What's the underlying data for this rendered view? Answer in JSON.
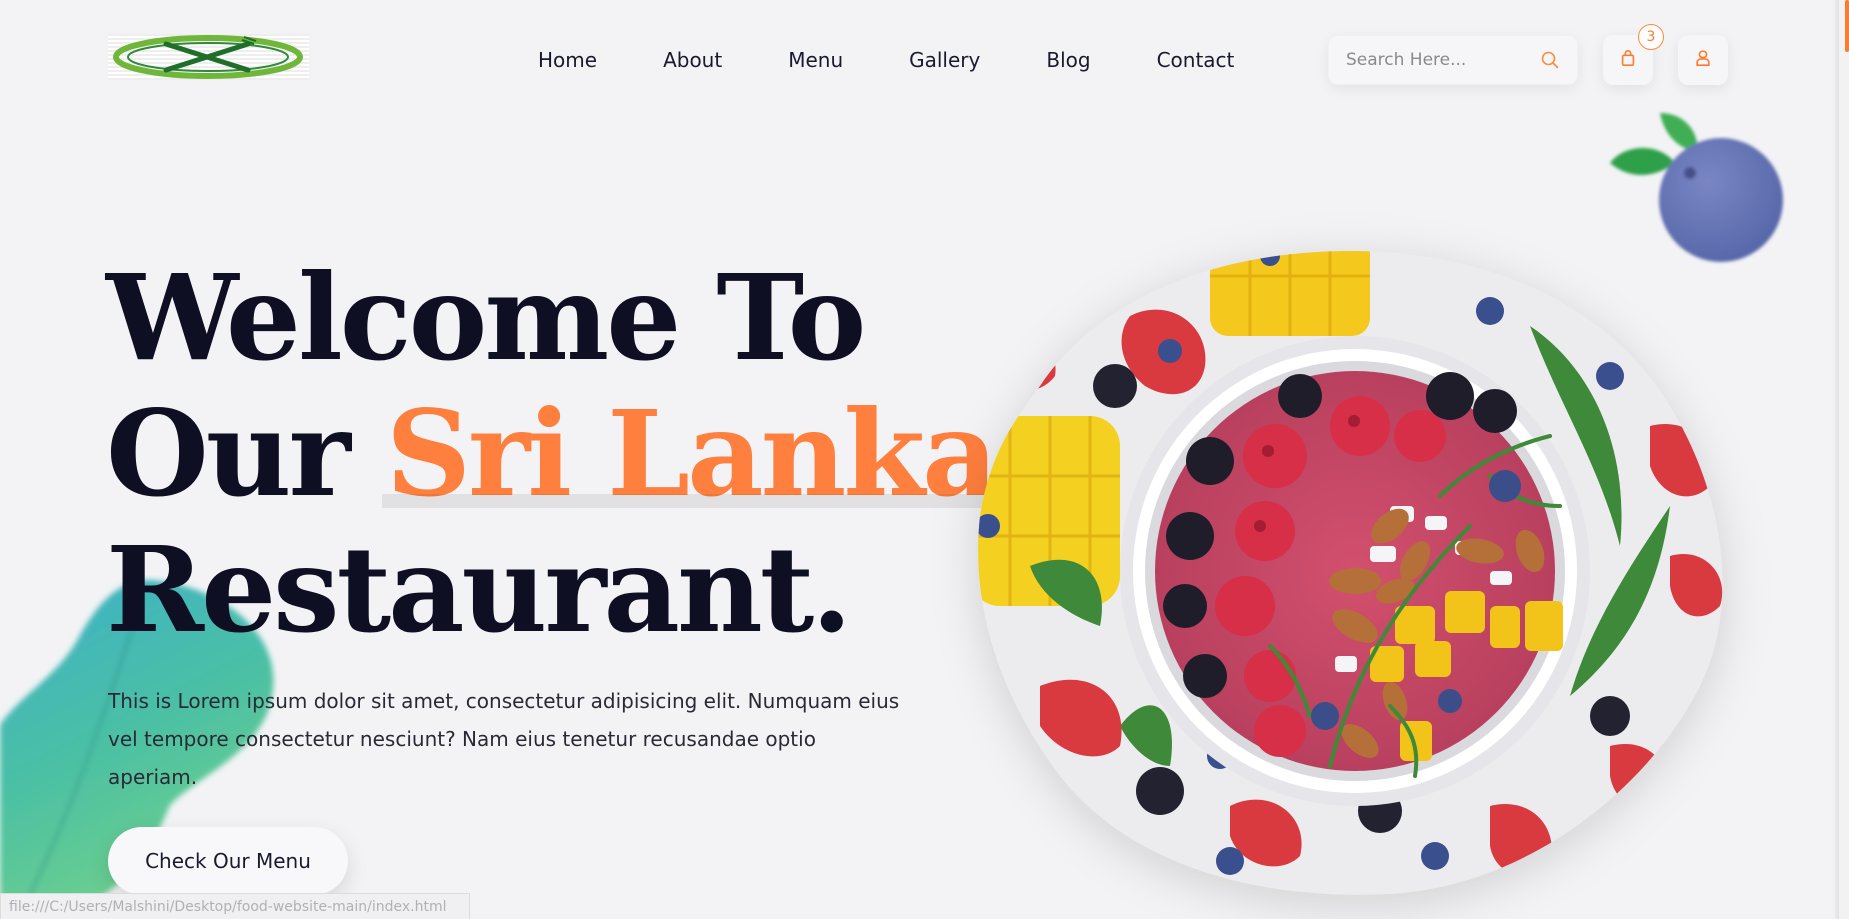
{
  "header": {
    "logo_alt": "Restaurant logo",
    "nav": [
      {
        "label": "Home"
      },
      {
        "label": "About"
      },
      {
        "label": "Menu"
      },
      {
        "label": "Gallery"
      },
      {
        "label": "Blog"
      },
      {
        "label": "Contact"
      }
    ],
    "search": {
      "placeholder": "Search Here...",
      "icon": "search-icon"
    },
    "cart": {
      "icon": "shopping-bag-icon",
      "count": "3"
    },
    "user": {
      "icon": "user-icon"
    }
  },
  "hero": {
    "title_line1": "Welcome To",
    "title_line2_prefix": "Our",
    "title_accent": "Sri Lanka",
    "title_line3": "Restaurant.",
    "description": "This is Lorem ipsum dolor sit amet, consectetur adipisicing elit. Numquam eius vel tempore consectetur nesciunt? Nam eius tenetur recusandae optio aperiam.",
    "cta_label": "Check Our Menu",
    "image_alt": "Smoothie bowl with berries, mango and almonds"
  },
  "status_bar": {
    "url": "file:///C:/Users/Malshini/Desktop/food-website-main/index.html"
  },
  "colors": {
    "accent": "#ff7f3e",
    "heading": "#0f0f23",
    "background": "#f3f3f5"
  }
}
